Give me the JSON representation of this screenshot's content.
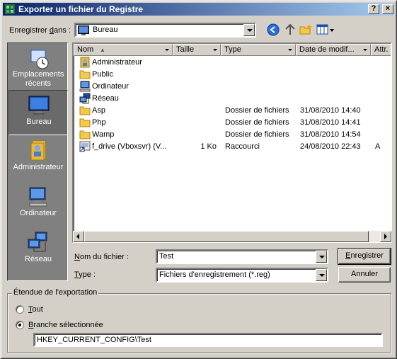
{
  "window": {
    "title": "Exporter un fichier du Registre",
    "help_label": "?",
    "close_label": "×"
  },
  "location": {
    "label_pre": "Enregistrer ",
    "label_accel": "d",
    "label_post": "ans :",
    "value": "Bureau"
  },
  "toolbar": {
    "back_icon": "back-icon",
    "up_icon": "up-folder-icon",
    "new_folder_icon": "new-folder-icon",
    "views_icon": "views-menu-icon"
  },
  "places": [
    {
      "label": "Emplacements récents",
      "icon": "recent-places-icon"
    },
    {
      "label": "Bureau",
      "icon": "desktop-icon",
      "selected": true
    },
    {
      "label": "Administrateur",
      "icon": "user-folder-icon"
    },
    {
      "label": "Ordinateur",
      "icon": "computer-icon"
    },
    {
      "label": "Réseau",
      "icon": "network-icon"
    }
  ],
  "columns": {
    "name": "Nom",
    "size": "Taille",
    "type": "Type",
    "date": "Date de modif...",
    "attr": "Attr."
  },
  "files": [
    {
      "name": "Administrateur",
      "size": "",
      "type": "",
      "date": "",
      "attr": "",
      "icon": "user-folder-icon"
    },
    {
      "name": "Public",
      "size": "",
      "type": "",
      "date": "",
      "attr": "",
      "icon": "folder-icon"
    },
    {
      "name": "Ordinateur",
      "size": "",
      "type": "",
      "date": "",
      "attr": "",
      "icon": "computer-icon"
    },
    {
      "name": "Réseau",
      "size": "",
      "type": "",
      "date": "",
      "attr": "",
      "icon": "network-icon"
    },
    {
      "name": "Asp",
      "size": "",
      "type": "Dossier de fichiers",
      "date": "31/08/2010 14:40",
      "attr": "",
      "icon": "folder-icon"
    },
    {
      "name": "Php",
      "size": "",
      "type": "Dossier de fichiers",
      "date": "31/08/2010 14:41",
      "attr": "",
      "icon": "folder-icon"
    },
    {
      "name": "Wamp",
      "size": "",
      "type": "Dossier de fichiers",
      "date": "31/08/2010 14:54",
      "attr": "",
      "icon": "folder-icon"
    },
    {
      "name": "f_drive (Vboxsvr) (V...",
      "size": "1 Ko",
      "type": "Raccourci",
      "date": "24/08/2010 22:43",
      "attr": "A",
      "icon": "shortcut-icon"
    }
  ],
  "filename": {
    "label_accel": "N",
    "label_post": "om du fichier :",
    "value": "Test"
  },
  "filetype": {
    "label_accel": "T",
    "label_post": "ype :",
    "value": "Fichiers d'enregistrement (*.reg)"
  },
  "buttons": {
    "save_accel": "E",
    "save_post": "nregistrer",
    "cancel": "Annuler"
  },
  "export_range": {
    "title": "Étendue de l'exportation",
    "all_accel": "T",
    "all_post": "out",
    "branch_accel": "B",
    "branch_post": "ranche sélectionnée",
    "selected": "branch",
    "branch_value": "HKEY_CURRENT_CONFIG\\Test"
  },
  "colors": {
    "title_start": "#0a246a",
    "title_end": "#a6caf0",
    "face": "#d4d0c8",
    "places_bg": "#808080"
  }
}
